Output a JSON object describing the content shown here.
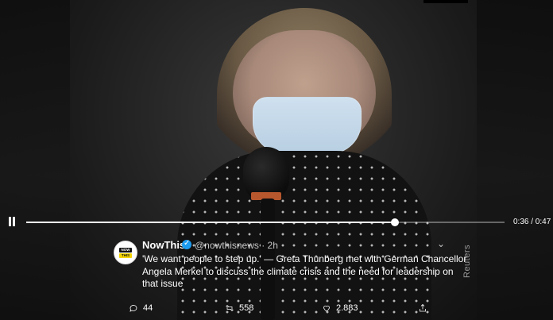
{
  "player": {
    "time_display": "0:36 / 0:47",
    "progress": 0.77,
    "watermark": "Reuters"
  },
  "tweet": {
    "account_name": "NowThis",
    "handle_and_time": "@nowthisnews · 2h",
    "text": "'We want people to step up.' — Greta Thunberg met with German Chancellor Angela Merkel to discuss the climate crisis and the need for leadership on that issue",
    "avatar_label_top": "NOW",
    "avatar_label_bottom": "THIS"
  },
  "actions": {
    "replies": "44",
    "retweets": "558",
    "likes": "2.883"
  },
  "colors": {
    "accent": "#1d9bf0",
    "logo_yellow": "#f4d400"
  },
  "icons": [
    "pause-icon",
    "verified-badge-icon",
    "chevron-down-icon",
    "reply-icon",
    "retweet-icon",
    "like-icon",
    "share-icon"
  ]
}
